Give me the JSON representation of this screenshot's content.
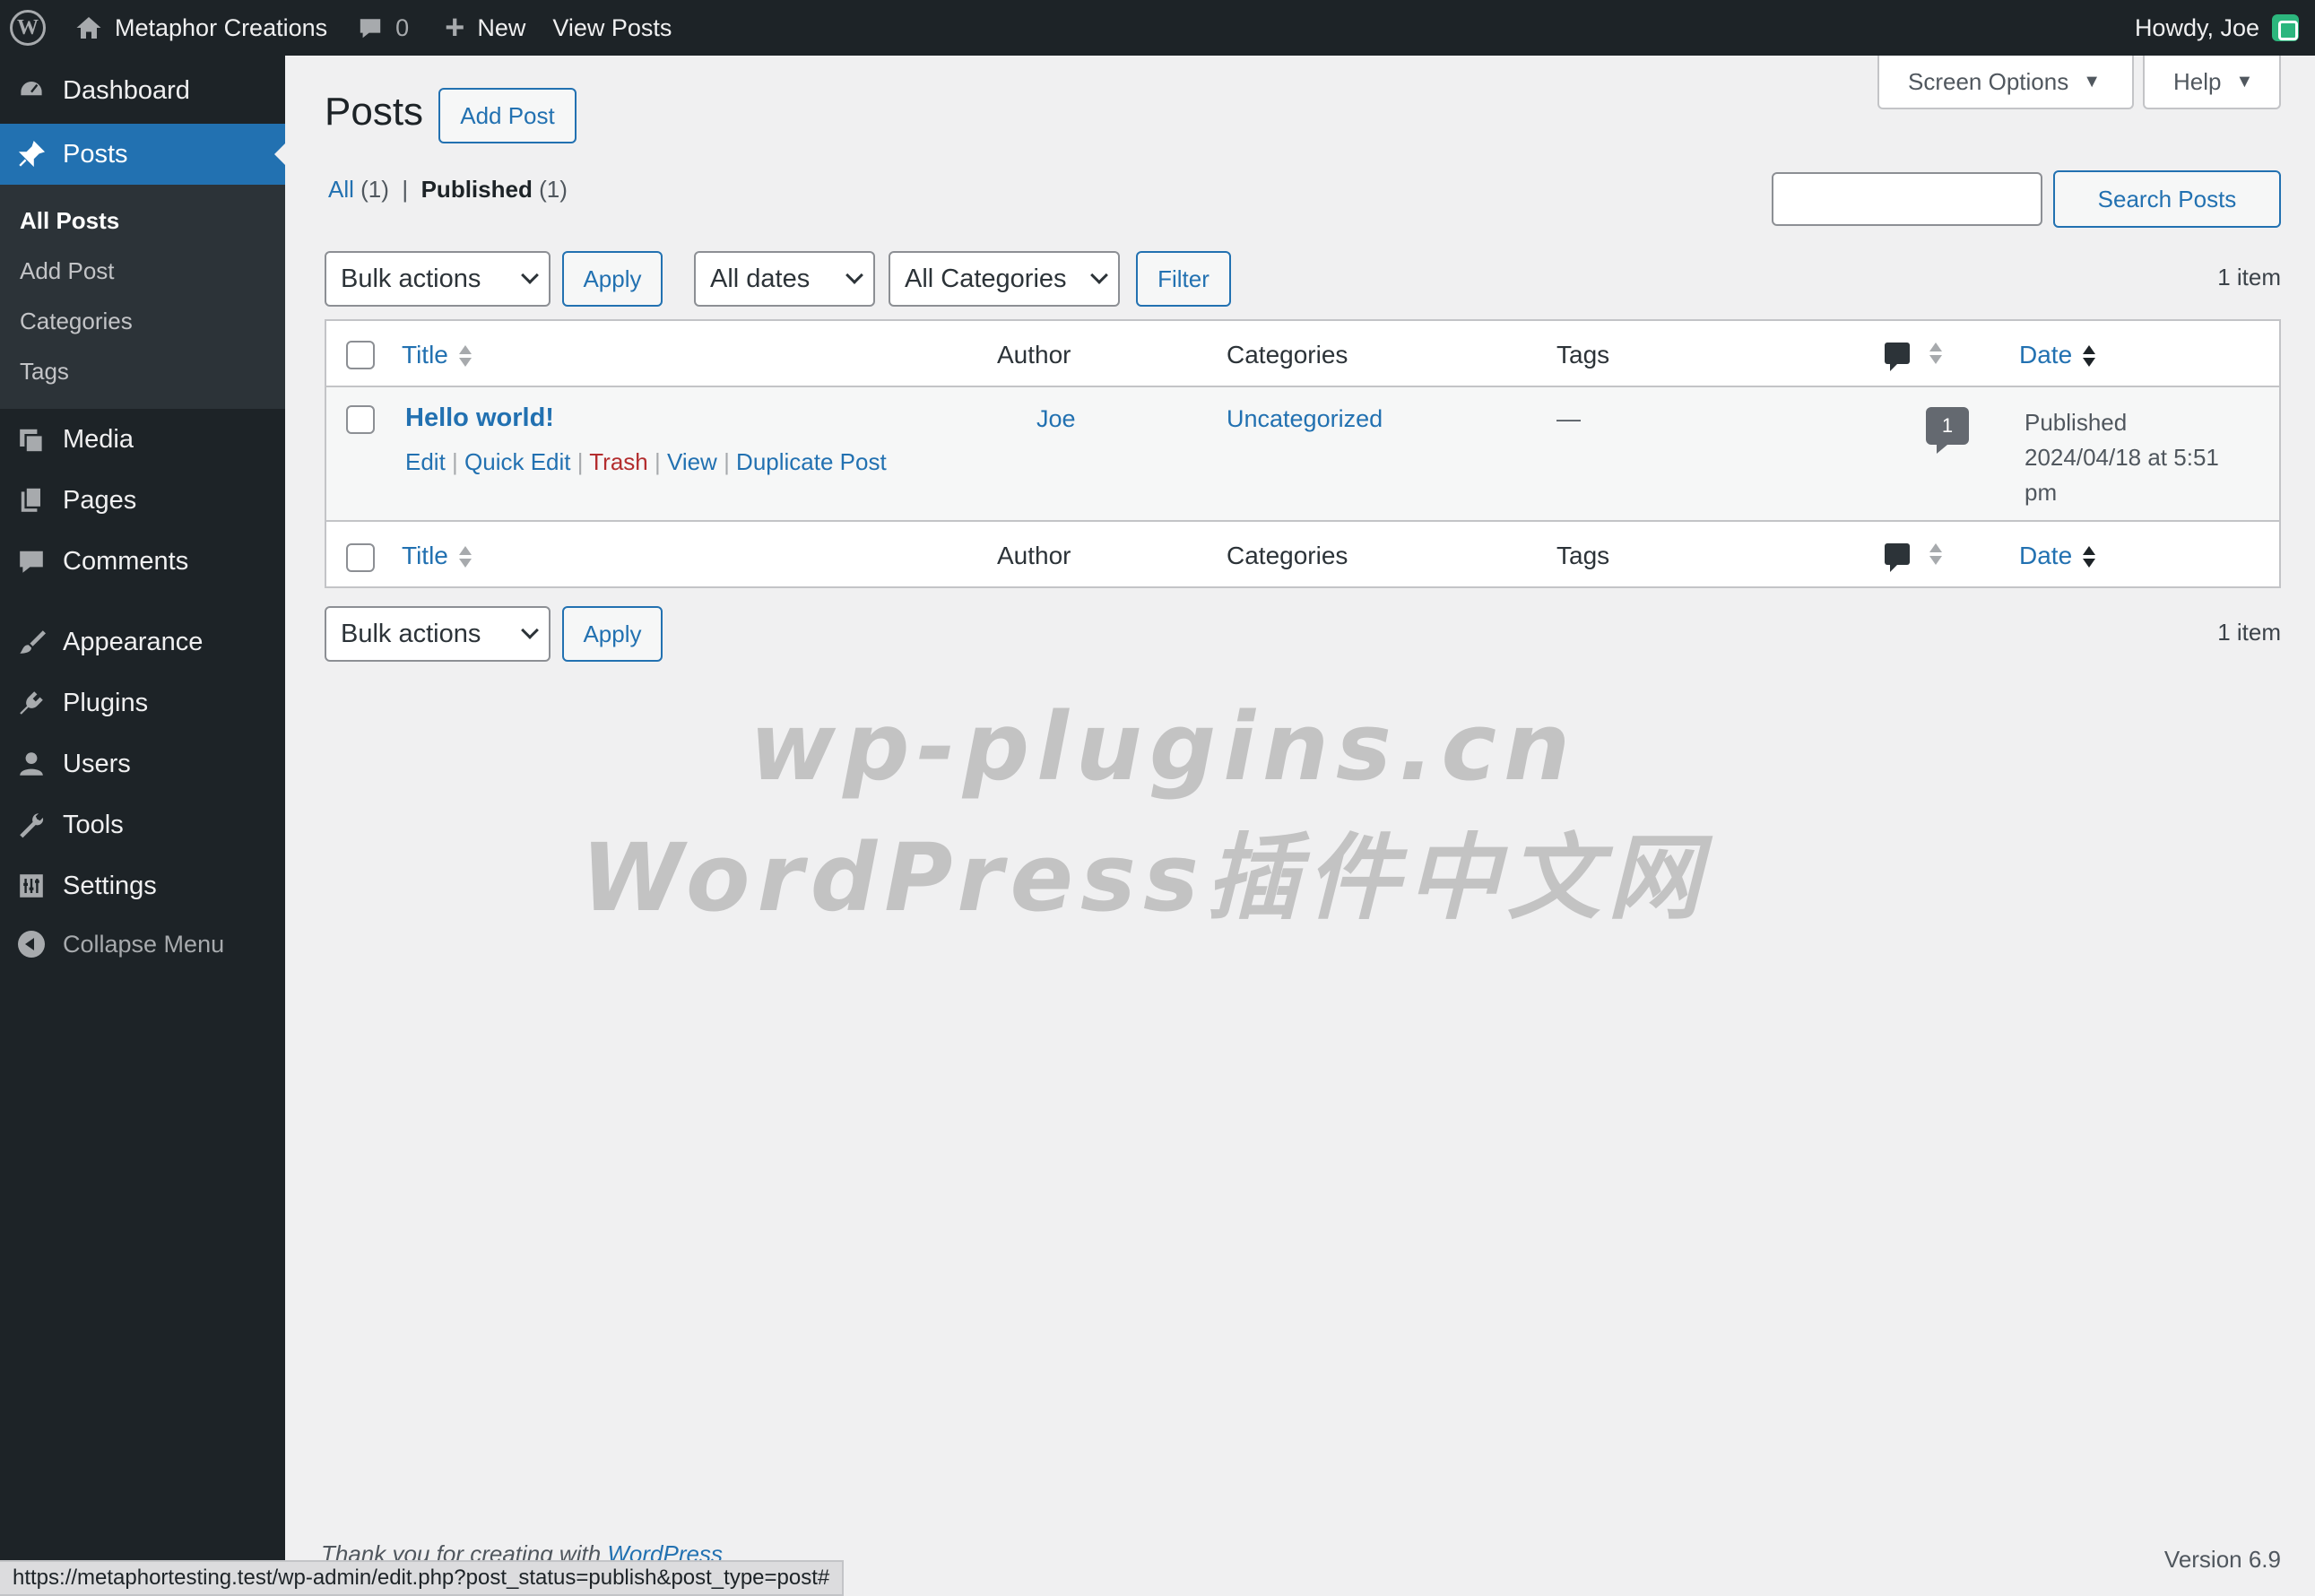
{
  "adminbar": {
    "site_name": "Metaphor Creations",
    "comments_count": "0",
    "new_label": "New",
    "view_posts_label": "View Posts",
    "howdy": "Howdy, Joe"
  },
  "sidebar": {
    "items": [
      {
        "label": "Dashboard",
        "icon": "dashboard-icon"
      },
      {
        "label": "Posts",
        "icon": "pin-icon"
      },
      {
        "label": "Media",
        "icon": "media-icon"
      },
      {
        "label": "Pages",
        "icon": "pages-icon"
      },
      {
        "label": "Comments",
        "icon": "comments-icon"
      },
      {
        "label": "Appearance",
        "icon": "brush-icon"
      },
      {
        "label": "Plugins",
        "icon": "plugin-icon"
      },
      {
        "label": "Users",
        "icon": "user-icon"
      },
      {
        "label": "Tools",
        "icon": "wrench-icon"
      },
      {
        "label": "Settings",
        "icon": "settings-icon"
      }
    ],
    "submenu": [
      "All Posts",
      "Add Post",
      "Categories",
      "Tags"
    ],
    "collapse": "Collapse Menu"
  },
  "header": {
    "screen_options": "Screen Options",
    "help": "Help",
    "title": "Posts",
    "add_post": "Add Post"
  },
  "filters": {
    "all_label": "All",
    "all_count": "(1)",
    "separator": "|",
    "published_label": "Published",
    "published_count": "(1)",
    "search_button": "Search Posts",
    "search_value": "",
    "bulk_actions": "Bulk actions",
    "apply": "Apply",
    "all_dates": "All dates",
    "all_categories": "All Categories",
    "filter": "Filter",
    "item_count": "1 item"
  },
  "table": {
    "columns": {
      "title": "Title",
      "author": "Author",
      "categories": "Categories",
      "tags": "Tags",
      "date": "Date"
    },
    "rows": [
      {
        "title": "Hello world!",
        "actions": {
          "edit": "Edit",
          "quick_edit": "Quick Edit",
          "trash": "Trash",
          "view": "View",
          "duplicate": "Duplicate Post"
        },
        "author": "Joe",
        "categories": "Uncategorized",
        "tags": "—",
        "comments": "1",
        "date_status": "Published",
        "date_line1": "2024/04/18 at 5:51",
        "date_line2": "pm"
      }
    ]
  },
  "watermark": {
    "line1": "wp-plugins.cn",
    "line2": "WordPress插件中文网"
  },
  "footer": {
    "thanks_prefix": "Thank you for creating with ",
    "thanks_link": "WordPress",
    "version": "Version 6.9"
  },
  "status_url": "https://metaphortesting.test/wp-admin/edit.php?post_status=publish&post_type=post#",
  "colors": {
    "accent": "#2271b1",
    "adminbar": "#1d2327",
    "trash": "#b32d2e"
  }
}
